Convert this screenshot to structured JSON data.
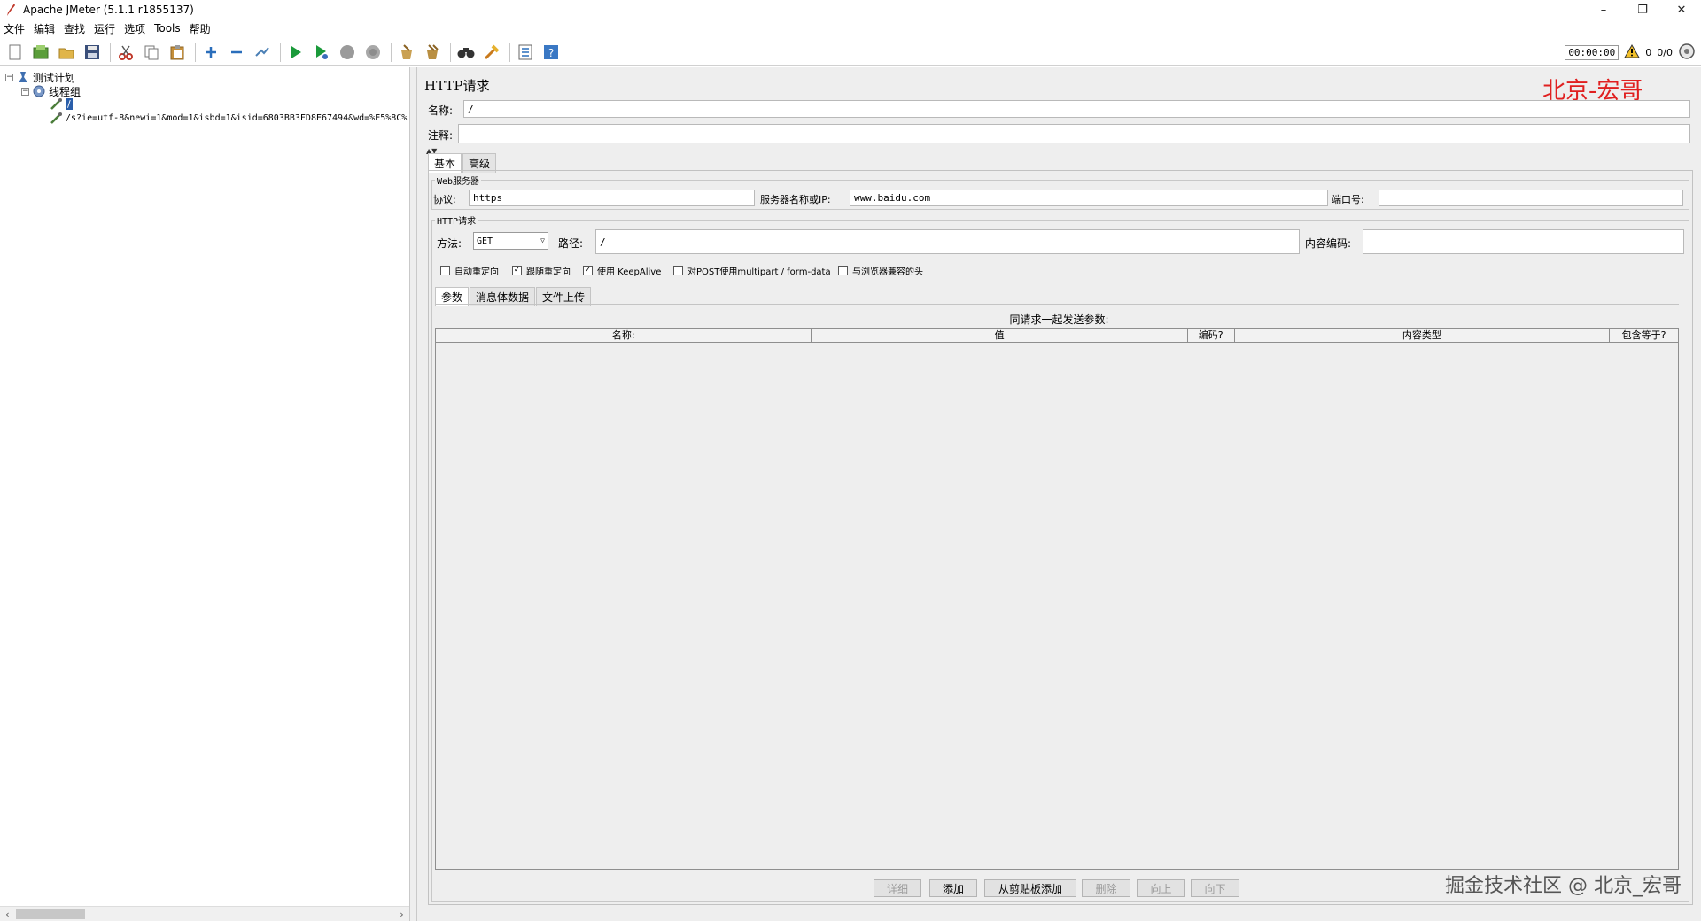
{
  "window": {
    "title": "Apache JMeter (5.1.1 r1855137)",
    "minimize": "–",
    "restore": "❐",
    "close": "✕"
  },
  "menu": [
    "文件",
    "编辑",
    "查找",
    "运行",
    "选项",
    "Tools",
    "帮助"
  ],
  "toolbar": {
    "timer": "00:00:00",
    "warnings": "0",
    "threads": "0/0"
  },
  "tree": {
    "plan": "测试计划",
    "thread_group": "线程组",
    "sampler_root": "/",
    "sampler_full": "/s?ie=utf-8&newi=1&mod=1&isbd=1&isid=6803BB3FD8E67494&wd=%E5%8C%"
  },
  "editor": {
    "title": "HTTP请求",
    "name_label": "名称:",
    "name_value": "/",
    "comment_label": "注释:",
    "comment_value": "",
    "tabs": [
      "基本",
      "高级"
    ],
    "web_server_group": "Web服务器",
    "protocol_label": "协议:",
    "protocol_value": "https",
    "server_label": "服务器名称或IP:",
    "server_value": "www.baidu.com",
    "port_label": "端口号:",
    "port_value": "",
    "http_group": "HTTP请求",
    "method_label": "方法:",
    "method_value": "GET",
    "path_label": "路径:",
    "path_value": "/",
    "encoding_label": "内容编码:",
    "encoding_value": "",
    "checkboxes": [
      {
        "label": "自动重定向",
        "checked": false
      },
      {
        "label": "跟随重定向",
        "checked": true
      },
      {
        "label": "使用 KeepAlive",
        "checked": true
      },
      {
        "label": "对POST使用multipart / form-data",
        "checked": false
      },
      {
        "label": "与浏览器兼容的头",
        "checked": false
      }
    ],
    "sub_tabs": [
      "参数",
      "消息体数据",
      "文件上传"
    ],
    "params_caption": "同请求一起发送参数:",
    "columns": [
      "名称:",
      "值",
      "编码?",
      "内容类型",
      "包含等于?"
    ],
    "buttons": [
      {
        "label": "详细",
        "enabled": false
      },
      {
        "label": "添加",
        "enabled": true
      },
      {
        "label": "从剪贴板添加",
        "enabled": true
      },
      {
        "label": "删除",
        "enabled": false
      },
      {
        "label": "向上",
        "enabled": false
      },
      {
        "label": "向下",
        "enabled": false
      }
    ]
  },
  "watermarks": {
    "top": "北京-宏哥",
    "bottom": "掘金技术社区 @ 北京_宏哥"
  },
  "colors": {
    "accent_red": "#e02020",
    "panel_bg": "#eeeeee",
    "run_green": "#1a9a3a"
  }
}
